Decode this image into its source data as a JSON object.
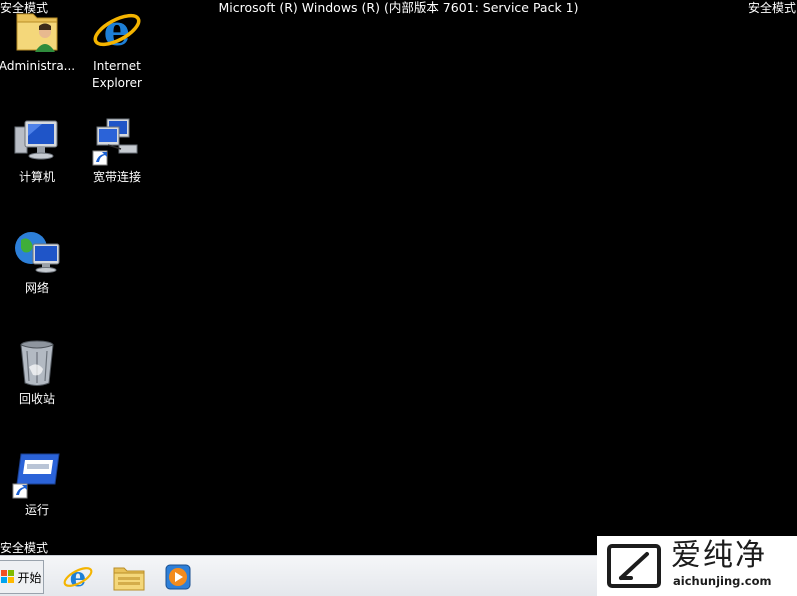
{
  "overlay": {
    "safe_mode_top_left": "安全模式",
    "safe_mode_top_right": "安全模式",
    "safe_mode_bottom_left": "安全模式",
    "build_text": "Microsoft (R) Windows (R) (内部版本 7601: Service Pack 1)"
  },
  "desktop": {
    "icons": [
      {
        "label": "Administra...",
        "icon": "user-folder-icon"
      },
      {
        "label": "Internet Explorer",
        "icon": "internet-explorer-icon"
      },
      {
        "label": "计算机",
        "icon": "computer-icon"
      },
      {
        "label": "宽带连接",
        "icon": "network-connection-shortcut-icon"
      },
      {
        "label": "网络",
        "icon": "network-globe-icon"
      },
      {
        "label": "回收站",
        "icon": "recycle-bin-icon"
      },
      {
        "label": "运行",
        "icon": "run-shortcut-icon"
      }
    ]
  },
  "taskbar": {
    "start_label": "开始",
    "pinned": [
      "internet-explorer-icon",
      "file-explorer-icon",
      "media-player-icon"
    ]
  },
  "watermark": {
    "name": "爱纯净",
    "url": "aichunjing.com"
  },
  "colors": {
    "desktop_bg": "#000000",
    "taskbar_bg": "#eceef1",
    "ie_blue": "#1e7fd6",
    "ie_ring": "#f4b400"
  }
}
